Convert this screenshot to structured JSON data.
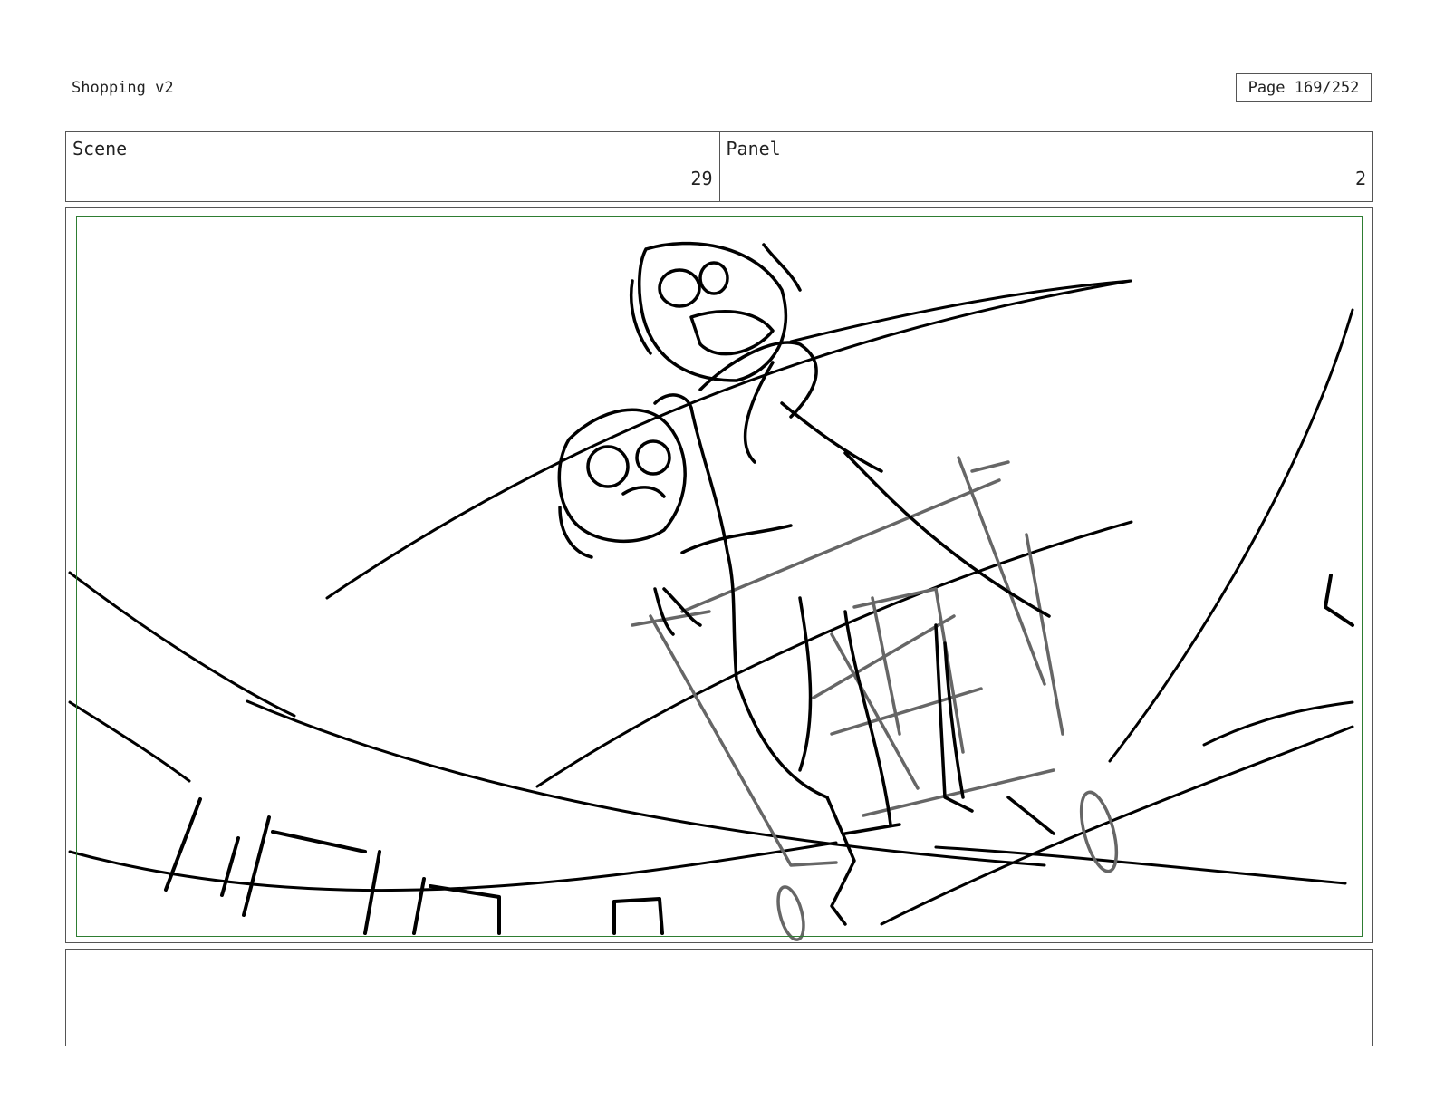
{
  "header": {
    "project_title": "Shopping v2",
    "page_label": "Page 169/252"
  },
  "info": {
    "scene_label": "Scene",
    "scene_value": "29",
    "panel_label": "Panel",
    "panel_value": "2"
  },
  "colors": {
    "border": "#555555",
    "safe_frame": "#2e7d32",
    "sketch_ink": "#000000",
    "construction_ink": "#666666"
  },
  "notes": {
    "text": ""
  }
}
